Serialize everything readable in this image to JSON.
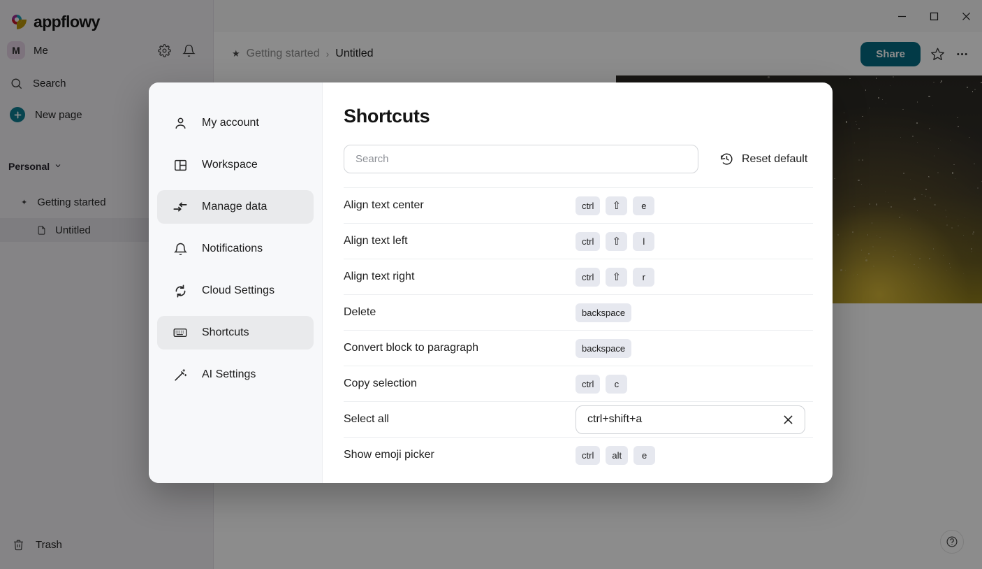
{
  "window": {
    "controls": [
      {
        "name": "minimize",
        "glyph": "minimize-icon"
      },
      {
        "name": "maximize",
        "glyph": "maximize-icon"
      },
      {
        "name": "close",
        "glyph": "close-icon"
      }
    ]
  },
  "sidebar": {
    "brand": "appflowy",
    "user": {
      "initial": "M",
      "name": "Me"
    },
    "actions": [
      {
        "name": "settings",
        "icon": "gear-icon"
      },
      {
        "name": "notifications",
        "icon": "bell-icon"
      }
    ],
    "nav": [
      {
        "label": "Search",
        "icon": "search-icon"
      },
      {
        "label": "New page",
        "icon": "plus-circle-icon"
      }
    ],
    "section": {
      "label": "Personal",
      "icon": "chevron-down-icon"
    },
    "tree": [
      {
        "label": "Getting started",
        "icon": "star-icon"
      },
      {
        "label": "Untitled",
        "icon": "document-icon",
        "selected": true
      }
    ],
    "trash": {
      "label": "Trash",
      "icon": "trash-icon"
    }
  },
  "document": {
    "breadcrumb": {
      "star": "★",
      "parent": "Getting started",
      "separator": "›",
      "current": "Untitled"
    },
    "share_label": "Share",
    "favorite_icon": "star-outline-icon",
    "more_icon": "ellipsis-icon",
    "help_label": "?"
  },
  "settings_modal": {
    "nav_items": [
      {
        "label": "My account",
        "icon": "person-icon",
        "state": "normal"
      },
      {
        "label": "Workspace",
        "icon": "layout-icon",
        "state": "normal"
      },
      {
        "label": "Manage data",
        "icon": "import-export-icon",
        "state": "hover"
      },
      {
        "label": "Notifications",
        "icon": "bell-icon",
        "state": "normal"
      },
      {
        "label": "Cloud Settings",
        "icon": "sync-icon",
        "state": "normal"
      },
      {
        "label": "Shortcuts",
        "icon": "keyboard-icon",
        "state": "active"
      },
      {
        "label": "AI Settings",
        "icon": "magic-wand-icon",
        "state": "normal"
      }
    ],
    "title": "Shortcuts",
    "search": {
      "value": "",
      "placeholder": "Search"
    },
    "reset": {
      "label": "Reset default",
      "icon": "history-icon"
    },
    "shortcuts": [
      {
        "name": "Align text center",
        "keys": [
          "ctrl",
          "⇧",
          "e"
        ],
        "editing": false
      },
      {
        "name": "Align text left",
        "keys": [
          "ctrl",
          "⇧",
          "l"
        ],
        "editing": false
      },
      {
        "name": "Align text right",
        "keys": [
          "ctrl",
          "⇧",
          "r"
        ],
        "editing": false
      },
      {
        "name": "Delete",
        "keys": [
          "backspace"
        ],
        "editing": false
      },
      {
        "name": "Convert block to paragraph",
        "keys": [
          "backspace"
        ],
        "editing": false
      },
      {
        "name": "Copy selection",
        "keys": [
          "ctrl",
          "c"
        ],
        "editing": false
      },
      {
        "name": "Select all",
        "keys": [],
        "editing": true,
        "edit_value": "ctrl+shift+a",
        "clear_icon": "close-icon"
      },
      {
        "name": "Show emoji picker",
        "keys": [
          "ctrl",
          "alt",
          "e"
        ],
        "editing": false
      }
    ]
  },
  "colors": {
    "accent": "#056b82",
    "sidebar_bg": "#f2f1f5",
    "modal_nav_bg": "#f7f8fa",
    "kbd_bg": "#e6e8ef",
    "nav_active_bg": "#e9eaec"
  }
}
